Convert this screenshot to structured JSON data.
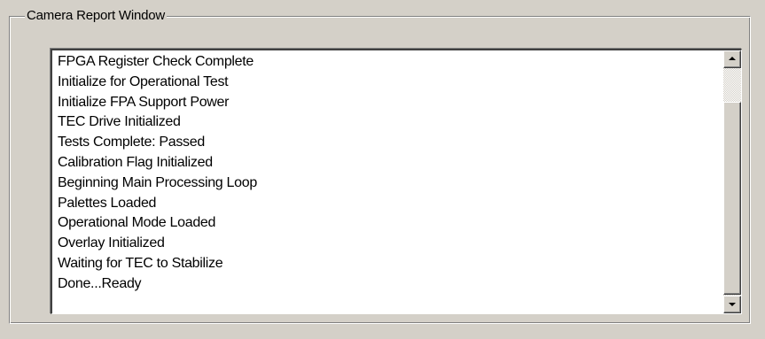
{
  "group": {
    "title": "Camera Report Window"
  },
  "report": {
    "items": [
      "FPGA Register Check Complete",
      "Initialize for Operational Test",
      "Initialize FPA Support Power",
      "TEC Drive Initialized",
      "Tests Complete: Passed",
      "Calibration Flag Initialized",
      "Beginning Main Processing Loop",
      "Palettes Loaded",
      "Operational Mode Loaded",
      "Overlay Initialized",
      "Waiting for TEC to Stabilize",
      "Done...Ready"
    ]
  },
  "scrollbar": {
    "up_icon": "arrow-up-icon",
    "down_icon": "arrow-down-icon",
    "scroll_position": 0.2
  },
  "colors": {
    "face": "#d4d0c8",
    "list_background": "#ffffff",
    "text": "#000000"
  }
}
